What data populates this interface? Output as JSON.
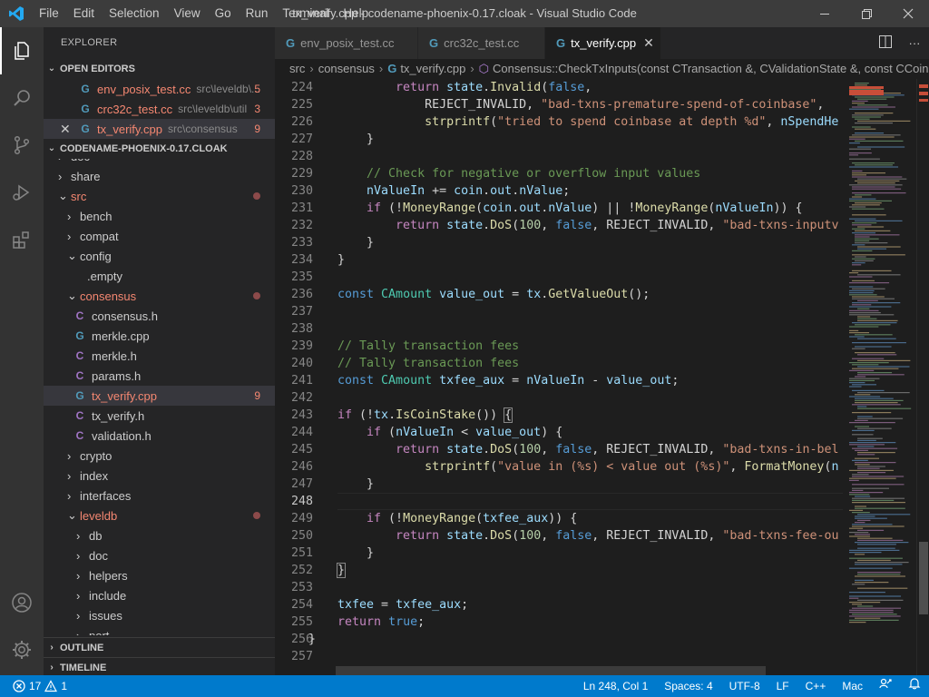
{
  "titlebar": {
    "menu": [
      "File",
      "Edit",
      "Selection",
      "View",
      "Go",
      "Run",
      "Terminal",
      "Help"
    ],
    "title": "tx_verify.cpp - codename-phoenix-0.17.cloak - Visual Studio Code"
  },
  "sidebar": {
    "title": "EXPLORER",
    "open_editors_label": "OPEN EDITORS",
    "open_editors": [
      {
        "name": "env_posix_test.cc",
        "path": "src\\leveldb\\...",
        "badge": "5"
      },
      {
        "name": "crc32c_test.cc",
        "path": "src\\leveldb\\util",
        "badge": "3"
      },
      {
        "name": "tx_verify.cpp",
        "path": "src\\consensus",
        "badge": "9"
      }
    ],
    "workspace_label": "CODENAME-PHOENIX-0.17.CLOAK",
    "tree": {
      "doc": "doc",
      "share": "share",
      "src": "src",
      "bench": "bench",
      "compat": "compat",
      "config": "config",
      "empty": ".empty",
      "consensus": "consensus",
      "consensus_h": "consensus.h",
      "merkle_cpp": "merkle.cpp",
      "merkle_h": "merkle.h",
      "params_h": "params.h",
      "tx_verify_cpp": "tx_verify.cpp",
      "tx_verify_cpp_badge": "9",
      "tx_verify_h": "tx_verify.h",
      "validation_h": "validation.h",
      "crypto": "crypto",
      "index": "index",
      "interfaces": "interfaces",
      "leveldb": "leveldb",
      "db": "db",
      "docs": "doc",
      "helpers": "helpers",
      "include": "include",
      "issues": "issues",
      "port": "port"
    },
    "outline_label": "OUTLINE",
    "timeline_label": "TIMELINE"
  },
  "tabs": [
    {
      "label": "env_posix_test.cc",
      "icon": "G"
    },
    {
      "label": "crc32c_test.cc",
      "icon": "G"
    },
    {
      "label": "tx_verify.cpp",
      "icon": "G"
    }
  ],
  "breadcrumb": {
    "parts": [
      "src",
      "consensus",
      "tx_verify.cpp",
      "Consensus::CheckTxInputs(const CTransaction &, CValidationState &, const CCoins"
    ]
  },
  "code": {
    "line_numbers": [
      "224",
      "225",
      "226",
      "227",
      "228",
      "229",
      "230",
      "231",
      "232",
      "233",
      "234",
      "235",
      "236",
      "237",
      "238",
      "239",
      "240",
      "241",
      "242",
      "243",
      "244",
      "245",
      "246",
      "247",
      "248",
      "249",
      "250",
      "251",
      "252",
      "253",
      "254",
      "255",
      "256",
      "257"
    ],
    "current_line": "248"
  },
  "statusbar": {
    "errors": "17",
    "warnings": "1",
    "position": "Ln 248, Col 1",
    "spaces": "Spaces: 4",
    "encoding": "UTF-8",
    "eol": "LF",
    "language": "C++",
    "platform": "Mac"
  },
  "colors": {
    "accent": "#007acc",
    "error": "#f48771"
  }
}
